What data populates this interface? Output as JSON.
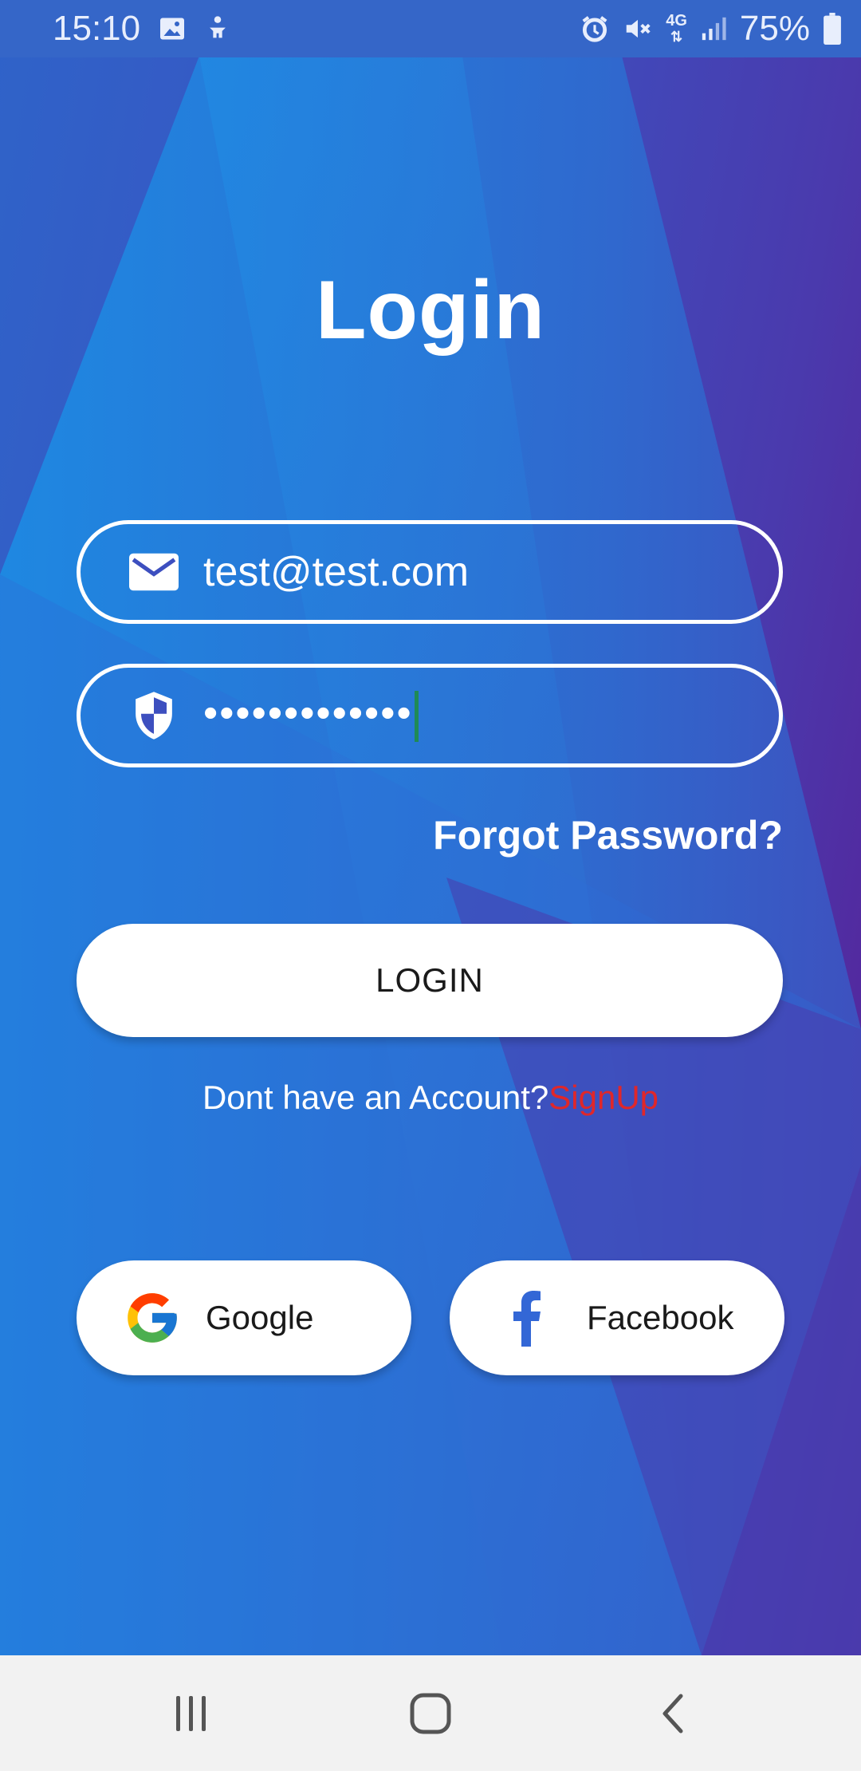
{
  "status_bar": {
    "time": "15:10",
    "network": "4G",
    "battery": "75%",
    "icons": [
      "image-icon",
      "accessibility-icon",
      "alarm-icon",
      "mute-icon",
      "network-4g-icon",
      "signal-icon",
      "battery-icon"
    ]
  },
  "login": {
    "title": "Login",
    "email_value": "test@test.com",
    "password_dots": "•••••••••••••",
    "forgot_label": "Forgot Password?",
    "login_button": "LOGIN",
    "signup_prompt": "Dont have an Account?",
    "signup_link": "SignUp"
  },
  "social": {
    "google_label": "Google",
    "facebook_label": "Facebook"
  },
  "colors": {
    "accent_link": "#e0272a",
    "background_left": "#1a8ee6",
    "background_right": "#581f96"
  }
}
